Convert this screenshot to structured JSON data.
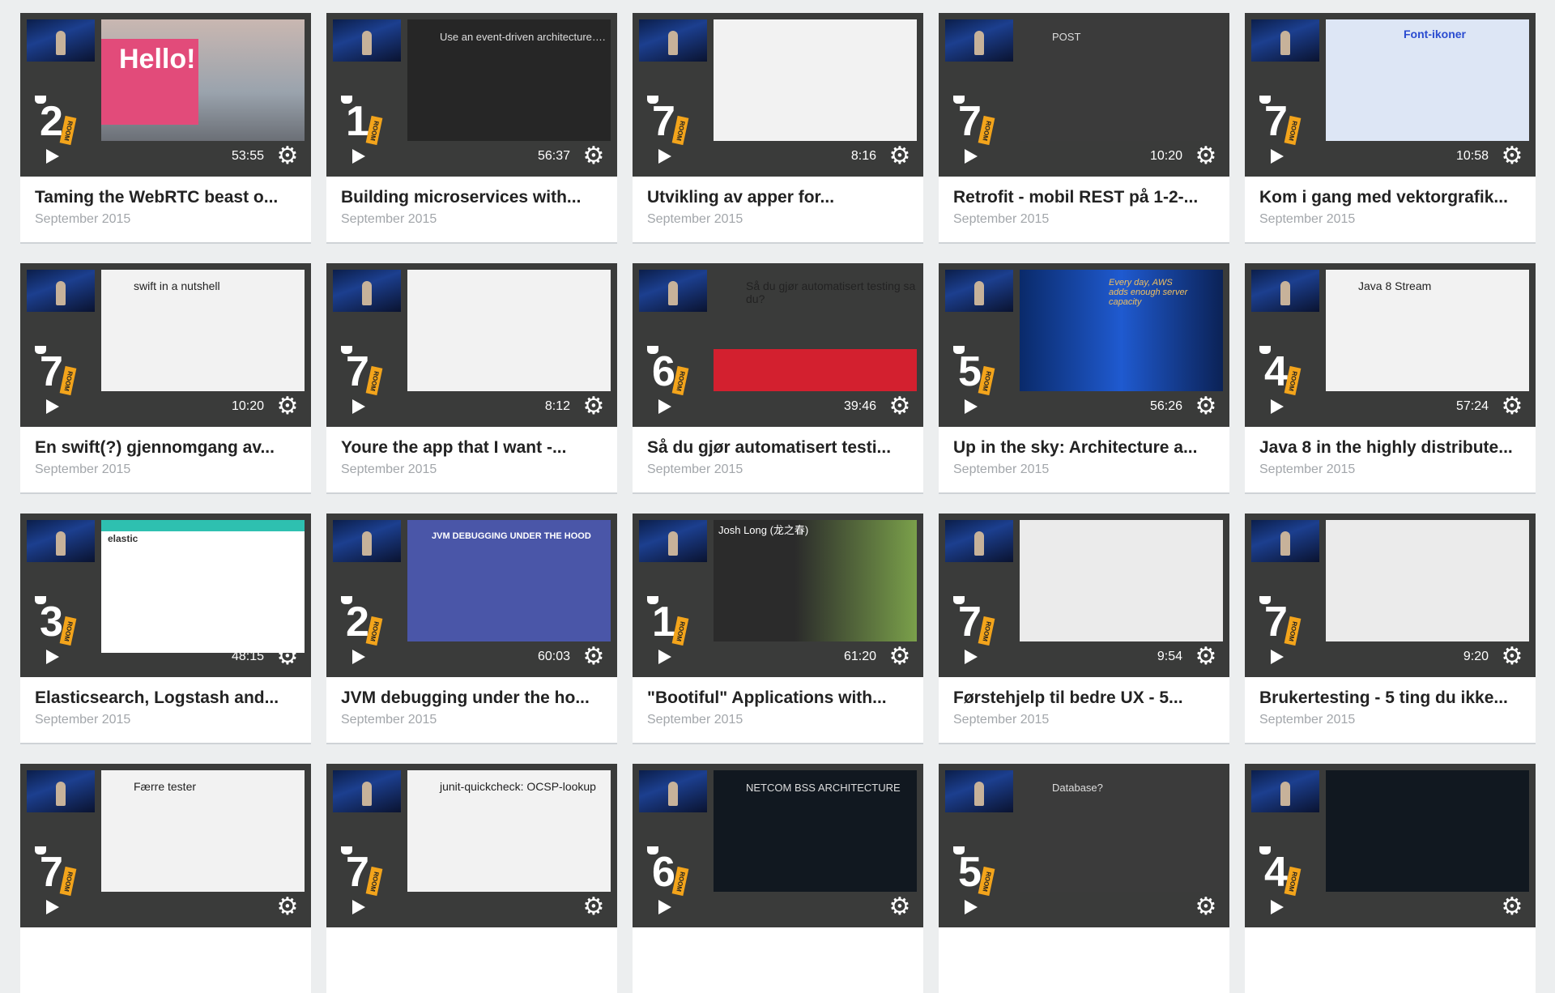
{
  "videos": [
    {
      "title": "Taming the WebRTC beast o...",
      "date": "September 2015",
      "duration": "53:55",
      "room": "2",
      "slide": "s-hello",
      "slide_text": "Hello!"
    },
    {
      "title": "Building microservices with...",
      "date": "September 2015",
      "duration": "56:37",
      "room": "1",
      "slide": "s-dark",
      "slide_text": "Use an event-driven architecture…."
    },
    {
      "title": "Utvikling av apper for...",
      "date": "September 2015",
      "duration": "8:16",
      "room": "7",
      "slide": "s-white",
      "slide_text": ""
    },
    {
      "title": "Retrofit - mobil REST på 1-2-...",
      "date": "September 2015",
      "duration": "10:20",
      "room": "7",
      "slide": "s-grey",
      "slide_text": "POST"
    },
    {
      "title": "Kom i gang med vektorgrafik...",
      "date": "September 2015",
      "duration": "10:58",
      "room": "7",
      "slide": "s-blue",
      "slide_text": "Font-ikoner"
    },
    {
      "title": "En swift(?) gjennomgang av...",
      "date": "September 2015",
      "duration": "10:20",
      "room": "7",
      "slide": "s-white",
      "slide_text": "swift in a nutshell"
    },
    {
      "title": "Youre the app that I want -...",
      "date": "September 2015",
      "duration": "8:12",
      "room": "7",
      "slide": "s-white",
      "slide_text": ""
    },
    {
      "title": "Så du gjør automatisert testi...",
      "date": "September 2015",
      "duration": "39:46",
      "room": "6",
      "slide": "s-red",
      "slide_text": "Så du gjør automatisert testing sa du?"
    },
    {
      "title": "Up in the sky: Architecture a...",
      "date": "September 2015",
      "duration": "56:26",
      "room": "5",
      "slide": "s-dc",
      "slide_text": "Every day, AWS adds enough server capacity"
    },
    {
      "title": "Java 8 in the highly distribute...",
      "date": "September 2015",
      "duration": "57:24",
      "room": "4",
      "slide": "s-white",
      "slide_text": "Java 8 Stream"
    },
    {
      "title": "Elasticsearch, Logstash and...",
      "date": "September 2015",
      "duration": "48:15",
      "room": "3",
      "slide": "s-elastic",
      "slide_text": "elastic"
    },
    {
      "title": "JVM debugging under the ho...",
      "date": "September 2015",
      "duration": "60:03",
      "room": "2",
      "slide": "s-jvm",
      "slide_text": "JVM DEBUGGING UNDER THE HOOD"
    },
    {
      "title": "\"Bootiful\" Applications with...",
      "date": "September 2015",
      "duration": "61:20",
      "room": "1",
      "slide": "s-spring",
      "slide_text": "Josh Long (龙之春)"
    },
    {
      "title": "Førstehjelp til bedre UX - 5...",
      "date": "September 2015",
      "duration": "9:54",
      "room": "7",
      "slide": "s-light",
      "slide_text": ""
    },
    {
      "title": "Brukertesting - 5 ting du ikke...",
      "date": "September 2015",
      "duration": "9:20",
      "room": "7",
      "slide": "s-light",
      "slide_text": ""
    },
    {
      "title": "",
      "date": "",
      "duration": "",
      "room": "7",
      "slide": "s-white",
      "slide_text": "Færre tester"
    },
    {
      "title": "",
      "date": "",
      "duration": "",
      "room": "7",
      "slide": "s-white",
      "slide_text": "junit-quickcheck: OCSP-lookup"
    },
    {
      "title": "",
      "date": "",
      "duration": "",
      "room": "6",
      "slide": "s-code",
      "slide_text": "NETCOM BSS ARCHITECTURE"
    },
    {
      "title": "",
      "date": "",
      "duration": "",
      "room": "5",
      "slide": "s-grey",
      "slide_text": "Database?"
    },
    {
      "title": "",
      "date": "",
      "duration": "",
      "room": "4",
      "slide": "s-code",
      "slide_text": ""
    }
  ],
  "icons": {
    "play": "play-icon",
    "settings": "gear-icon"
  },
  "colors": {
    "background": "#eceeef",
    "card": "#ffffff",
    "thumb": "#3a3b3a",
    "room_tag": "#f3a41b",
    "date": "#a2a6aa"
  }
}
